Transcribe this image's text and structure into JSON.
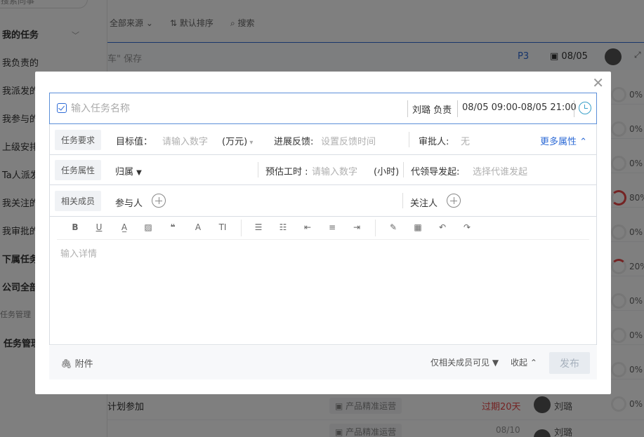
{
  "sidebar": {
    "search_placeholder": "搜索同事",
    "sections": [
      {
        "label": "我的任务",
        "bold": true
      },
      {
        "label": "我负责的"
      },
      {
        "label": "我派发的"
      },
      {
        "label": "我参与的"
      },
      {
        "label": "上级安排"
      },
      {
        "label": "Ta人派发"
      },
      {
        "label": "我关注的"
      },
      {
        "label": "我审批的"
      },
      {
        "label": "下属任务",
        "bold": true
      },
      {
        "label": "公司全部",
        "bold": true
      },
      {
        "label": "任务管理"
      },
      {
        "label": "任务管理",
        "bold": true
      }
    ]
  },
  "toolbar": {
    "source_filter": "全部来源 ⌄",
    "sort": "⇅ 默认排序",
    "search": "⌕ 搜索"
  },
  "top_task": {
    "title": "车\" 保存",
    "priority": "P3",
    "date": "08/05"
  },
  "task_progress": [
    "0%",
    "0%",
    "0%",
    "80%",
    "0%",
    "20%",
    "0%",
    "0%",
    "0%",
    "0%"
  ],
  "bottom_task": {
    "title": "计划参加",
    "project": "产品精准运营",
    "overdue": "过期20天",
    "owner": "刘璐",
    "progress": "0%",
    "next_date": "08/10",
    "next_owner": "刘璐"
  },
  "modal": {
    "name_placeholder": "输入任务名称",
    "owner": "刘璐 负责",
    "date_range": "08/05 09:00-08/05 21:00",
    "requirements": {
      "tag": "任务要求",
      "target_label": "目标值：",
      "target_placeholder": "请输入数字",
      "unit": "(万元)",
      "feedback_label": "进展反馈:",
      "feedback_placeholder": "设置反馈时间",
      "approver_label": "审批人:",
      "approver_value": "无",
      "more": "更多属性"
    },
    "attributes": {
      "tag": "任务属性",
      "belongs": "归属",
      "hours_label": "预估工时 :",
      "hours_placeholder": "请输入数字",
      "hours_unit": "(小时)",
      "proxy_label": "代领导发起:",
      "proxy_placeholder": "选择代谁发起"
    },
    "members": {
      "tag": "相关成员",
      "participants": "参与人",
      "followers": "关注人"
    },
    "editor_placeholder": "输入详情",
    "footer": {
      "attachment": "附件",
      "visibility": "仅相关成员可见 ▼",
      "collapse": "收起 ⌃",
      "publish": "发布"
    }
  }
}
